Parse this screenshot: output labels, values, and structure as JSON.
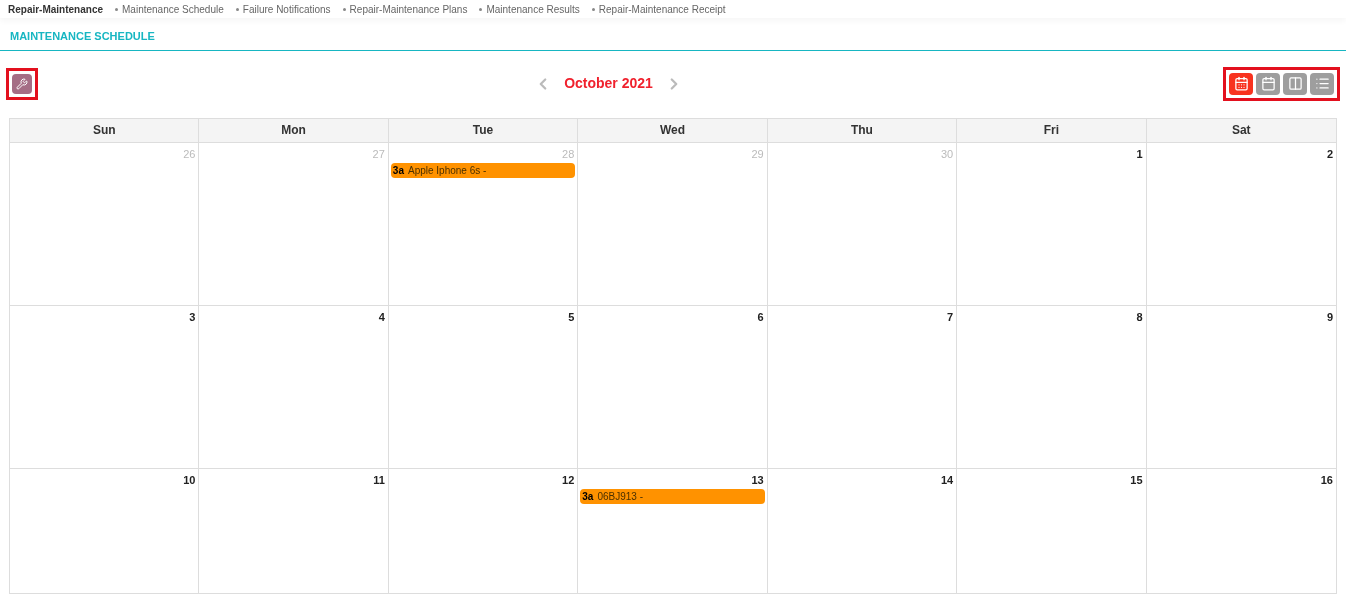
{
  "breadcrumb": [
    {
      "label": "Repair-Maintenance",
      "selected": true
    },
    {
      "label": "Maintenance Schedule",
      "selected": false
    },
    {
      "label": "Failure Notifications",
      "selected": false
    },
    {
      "label": "Repair-Maintenance Plans",
      "selected": false
    },
    {
      "label": "Maintenance Results",
      "selected": false
    },
    {
      "label": "Repair-Maintenance Receipt",
      "selected": false
    }
  ],
  "page_title": "MAINTENANCE SCHEDULE",
  "toolbar": {
    "month": "October 2021",
    "views": [
      {
        "kind": "day",
        "selected": true
      },
      {
        "kind": "month",
        "selected": false
      },
      {
        "kind": "week",
        "selected": false
      },
      {
        "kind": "list",
        "selected": false
      }
    ]
  },
  "calendar": {
    "weekdays": [
      "Sun",
      "Mon",
      "Tue",
      "Wed",
      "Thu",
      "Fri",
      "Sat"
    ],
    "weeks": [
      [
        {
          "day": "26",
          "other_month": true
        },
        {
          "day": "27",
          "other_month": true
        },
        {
          "day": "28",
          "other_month": true,
          "events": [
            {
              "time": "3a",
              "title": "Apple Iphone 6s -"
            }
          ]
        },
        {
          "day": "29",
          "other_month": true
        },
        {
          "day": "30",
          "other_month": true
        },
        {
          "day": "1",
          "other_month": false
        },
        {
          "day": "2",
          "other_month": false
        }
      ],
      [
        {
          "day": "3",
          "other_month": false
        },
        {
          "day": "4",
          "other_month": false
        },
        {
          "day": "5",
          "other_month": false
        },
        {
          "day": "6",
          "other_month": false
        },
        {
          "day": "7",
          "other_month": false
        },
        {
          "day": "8",
          "other_month": false
        },
        {
          "day": "9",
          "other_month": false
        }
      ],
      [
        {
          "day": "10",
          "other_month": false
        },
        {
          "day": "11",
          "other_month": false
        },
        {
          "day": "12",
          "other_month": false
        },
        {
          "day": "13",
          "other_month": false,
          "events": [
            {
              "time": "3a",
              "title": "06BJ913 -"
            }
          ]
        },
        {
          "day": "14",
          "other_month": false
        },
        {
          "day": "15",
          "other_month": false
        },
        {
          "day": "16",
          "other_month": false
        }
      ]
    ]
  }
}
